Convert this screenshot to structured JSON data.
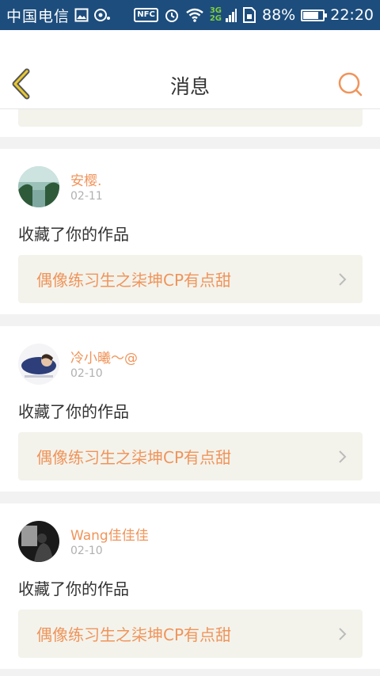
{
  "status_bar": {
    "carrier": "中国电信",
    "nfc": "NFC",
    "network": [
      "3G",
      "2G"
    ],
    "battery_percent": "88%",
    "battery_level": 0.88,
    "time": "22:20"
  },
  "header": {
    "title": "消息",
    "back_icon": "chevron-left-icon",
    "search_icon": "search-icon"
  },
  "notifications": [
    {
      "username": "安樱.",
      "date": "02-11",
      "action": "收藏了你的作品",
      "work_title": "偶像练习生之柒坤CP有点甜"
    },
    {
      "username": "冷小曦～@",
      "date": "02-10",
      "action": "收藏了你的作品",
      "work_title": "偶像练习生之柒坤CP有点甜"
    },
    {
      "username": "Wang佳佳佳",
      "date": "02-10",
      "action": "收藏了你的作品",
      "work_title": "偶像练习生之柒坤CP有点甜"
    }
  ],
  "colors": {
    "accent": "#f0945a",
    "status_bar": "#1d4d7d",
    "back_icon": "#e0c030",
    "card_bg": "#f3f3ec"
  }
}
